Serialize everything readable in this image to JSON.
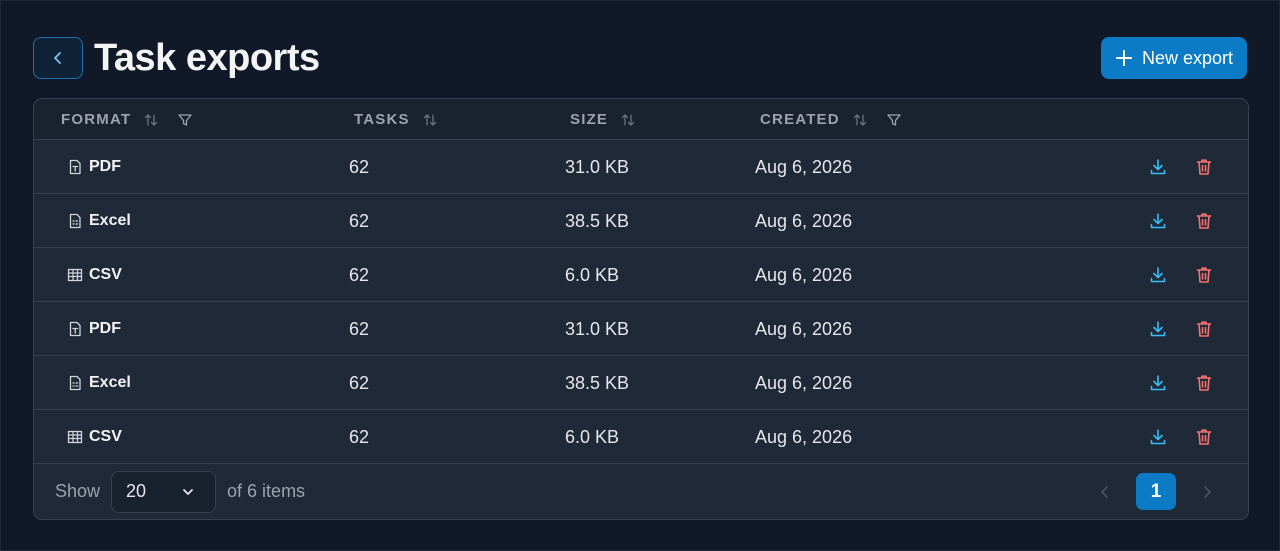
{
  "header": {
    "title": "Task exports",
    "new_button_label": "New export"
  },
  "columns": [
    {
      "label": "FORMAT"
    },
    {
      "label": "TASKS"
    },
    {
      "label": "SIZE"
    },
    {
      "label": "CREATED"
    }
  ],
  "rows": [
    {
      "format": "PDF",
      "icon": "pdf-file-icon",
      "tasks": "62",
      "size": "31.0 KB",
      "created": "Aug 6, 2026"
    },
    {
      "format": "Excel",
      "icon": "excel-file-icon",
      "tasks": "62",
      "size": "38.5 KB",
      "created": "Aug 6, 2026"
    },
    {
      "format": "CSV",
      "icon": "table-icon",
      "tasks": "62",
      "size": "6.0 KB",
      "created": "Aug 6, 2026"
    },
    {
      "format": "PDF",
      "icon": "pdf-file-icon",
      "tasks": "62",
      "size": "31.0 KB",
      "created": "Aug 6, 2026"
    },
    {
      "format": "Excel",
      "icon": "excel-file-icon",
      "tasks": "62",
      "size": "38.5 KB",
      "created": "Aug 6, 2026"
    },
    {
      "format": "CSV",
      "icon": "table-icon",
      "tasks": "62",
      "size": "6.0 KB",
      "created": "Aug 6, 2026"
    }
  ],
  "footer": {
    "show_label": "Show",
    "page_size": "20",
    "of_items": "of 6 items",
    "current_page": "1"
  },
  "colors": {
    "background": "#111827",
    "card": "#1f2937",
    "accent": "#0a7bc4",
    "download": "#38bdf8",
    "delete": "#f87171"
  }
}
